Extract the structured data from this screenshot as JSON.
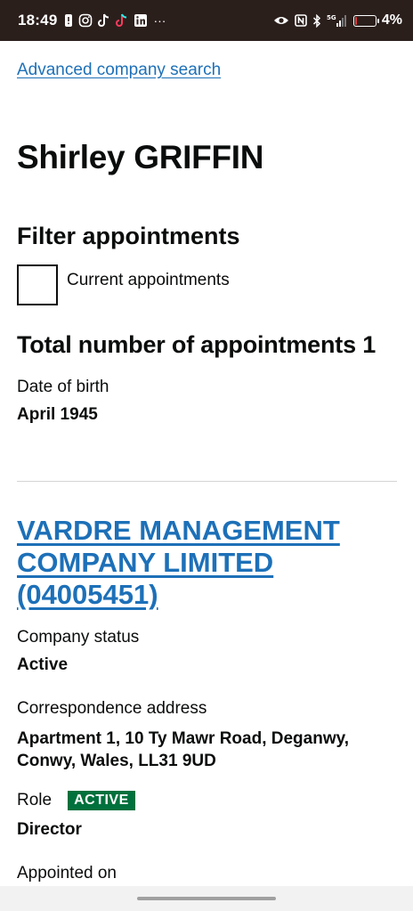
{
  "status_bar": {
    "time": "18:49",
    "left_icons": [
      "notification-alert-icon",
      "instagram-icon",
      "tiktok-icon",
      "tiktok-icon",
      "linkedin-icon",
      "more-dots-icon"
    ],
    "more_dots": "···",
    "right_icons": [
      "eye-icon",
      "nfc-icon",
      "bluetooth-icon",
      "signal-5g-icon",
      "battery-icon"
    ],
    "network": "5G",
    "battery_percent_text": "4%",
    "battery_level": 0.04,
    "battery_color": "#e23c3c"
  },
  "page": {
    "advanced_search_link": "Advanced company search",
    "officer_name": "Shirley GRIFFIN",
    "filter": {
      "title": "Filter appointments",
      "checkbox_label": "Current appointments",
      "checked": false
    },
    "total_appointments": "Total number of appointments 1",
    "date_of_birth_label": "Date of birth",
    "date_of_birth_value": "April 1945"
  },
  "appointment": {
    "company_link": "VARDRE MANAGEMENT COMPANY LIMITED (04005451)",
    "company_status_label": "Company status",
    "company_status_value": "Active",
    "correspondence_address_label": "Correspondence address",
    "correspondence_address_value": "Apartment 1, 10 Ty Mawr Road, Deganwy, Conwy, Wales, LL31 9UD",
    "role_label": "Role",
    "role_badge": "ACTIVE",
    "role_value": "Director",
    "appointed_on_label": "Appointed on"
  },
  "colors": {
    "link": "#1d70b8",
    "text": "#0b0c0c",
    "badge_green": "#00703c",
    "status_bar_bg": "#2b1f1c"
  }
}
